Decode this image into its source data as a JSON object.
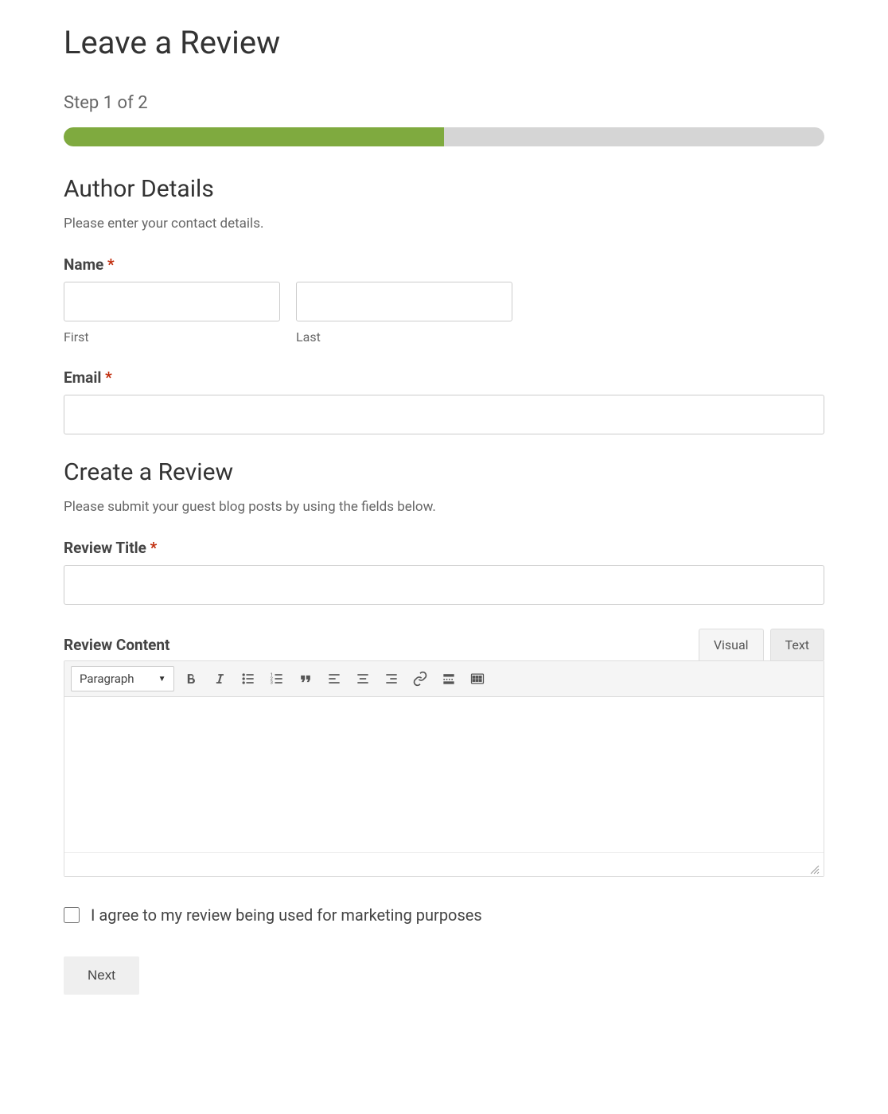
{
  "page": {
    "title": "Leave a Review",
    "step_label": "Step 1 of 2",
    "progress_percent": 50
  },
  "sections": {
    "author": {
      "heading": "Author Details",
      "description": "Please enter your contact details."
    },
    "review": {
      "heading": "Create a Review",
      "description": "Please submit your guest blog posts by using the fields below."
    }
  },
  "fields": {
    "name": {
      "label": "Name",
      "required_mark": "*",
      "first_value": "",
      "last_value": "",
      "first_sublabel": "First",
      "last_sublabel": "Last"
    },
    "email": {
      "label": "Email",
      "required_mark": "*",
      "value": ""
    },
    "review_title": {
      "label": "Review Title",
      "required_mark": "*",
      "value": ""
    },
    "review_content": {
      "label": "Review Content",
      "tabs": {
        "visual": "Visual",
        "text": "Text"
      },
      "active_tab": "Visual",
      "format_selector": "Paragraph",
      "body": ""
    },
    "consent": {
      "label": "I agree to my review being used for marketing purposes",
      "checked": false
    }
  },
  "buttons": {
    "next": "Next"
  },
  "colors": {
    "progress_fill": "#7faa3f",
    "progress_bg": "#d5d5d5",
    "required": "#c02b0a"
  }
}
